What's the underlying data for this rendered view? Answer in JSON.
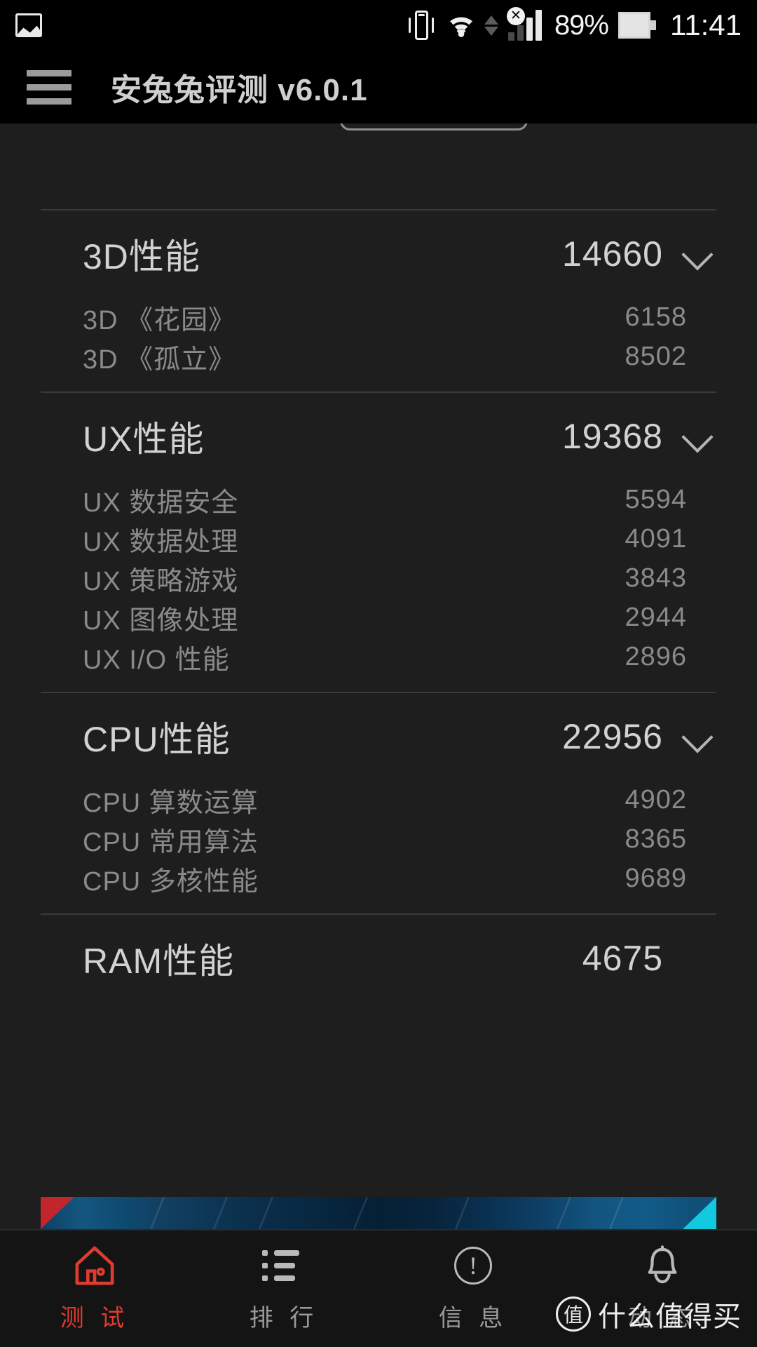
{
  "status_bar": {
    "gallery_icon": "gallery-icon",
    "vibrate_icon": "vibrate-icon",
    "wifi_icon": "wifi-icon",
    "data_transfer_icon": "data-transfer-arrows-icon",
    "signal_icon": "signal-bars-no-service-icon",
    "no_service_mark": "✕",
    "battery_percent": "89%",
    "battery_icon": "battery-icon",
    "time": "11:41"
  },
  "app_bar": {
    "menu_icon": "hamburger-menu-icon",
    "title": "安兔兔评测 v6.0.1"
  },
  "sections": [
    {
      "title": "3D性能",
      "score": "14660",
      "expandable": true,
      "chevron_icon": "chevron-down-icon",
      "items": [
        {
          "label": "3D 《花园》",
          "value": "6158"
        },
        {
          "label": "3D 《孤立》",
          "value": "8502"
        }
      ]
    },
    {
      "title": "UX性能",
      "score": "19368",
      "expandable": true,
      "chevron_icon": "chevron-down-icon",
      "items": [
        {
          "label": "UX 数据安全",
          "value": "5594"
        },
        {
          "label": "UX 数据处理",
          "value": "4091"
        },
        {
          "label": "UX 策略游戏",
          "value": "3843"
        },
        {
          "label": "UX 图像处理",
          "value": "2944"
        },
        {
          "label": "UX I/O 性能",
          "value": "2896"
        }
      ]
    },
    {
      "title": "CPU性能",
      "score": "22956",
      "expandable": true,
      "chevron_icon": "chevron-down-icon",
      "items": [
        {
          "label": "CPU 算数运算",
          "value": "4902"
        },
        {
          "label": "CPU 常用算法",
          "value": "8365"
        },
        {
          "label": "CPU 多核性能",
          "value": "9689"
        }
      ]
    },
    {
      "title": "RAM性能",
      "score": "4675",
      "expandable": false,
      "chevron_icon": "",
      "items": []
    }
  ],
  "bottom_nav": {
    "items": [
      {
        "label": "测 试",
        "icon": "home-icon",
        "active": true
      },
      {
        "label": "排 行",
        "icon": "list-icon",
        "active": false
      },
      {
        "label": "信 息",
        "icon": "info-circle-icon",
        "active": false
      },
      {
        "label": "动 态",
        "icon": "bell-icon",
        "active": false
      }
    ],
    "active_color": "#e03b2f",
    "inactive_color": "#9a9a9a"
  },
  "watermark": {
    "badge": "值",
    "text": "什么值得买"
  }
}
